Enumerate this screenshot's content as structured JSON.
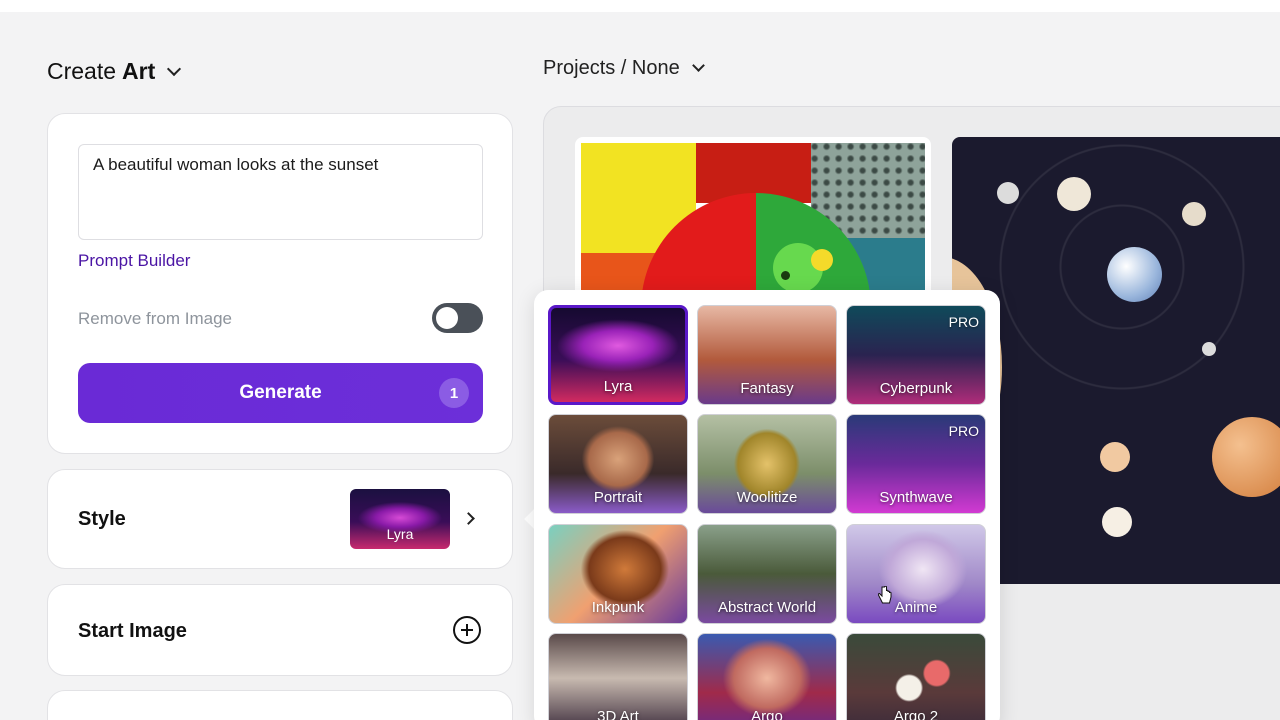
{
  "header": {
    "create_prefix": "Create",
    "create_bold": "Art",
    "projects_label": "Projects / None"
  },
  "prompt": {
    "text": "A beautiful woman looks at the sunset",
    "builder_link": "Prompt Builder",
    "remove_label": "Remove from Image",
    "remove_toggle_on": false,
    "generate_label": "Generate",
    "generate_count": "1"
  },
  "style_card": {
    "label": "Style",
    "selected_style": "Lyra"
  },
  "start_image": {
    "label": "Start Image"
  },
  "styles": [
    {
      "name": "Lyra",
      "pro": "",
      "selected": true
    },
    {
      "name": "Fantasy",
      "pro": ""
    },
    {
      "name": "Cyberpunk",
      "pro": "PRO"
    },
    {
      "name": "Portrait",
      "pro": ""
    },
    {
      "name": "Woolitize",
      "pro": ""
    },
    {
      "name": "Synthwave",
      "pro": "PRO"
    },
    {
      "name": "Inkpunk",
      "pro": ""
    },
    {
      "name": "Abstract World",
      "pro": ""
    },
    {
      "name": "Anime",
      "pro": ""
    },
    {
      "name": "3D Art",
      "pro": ""
    },
    {
      "name": "Argo",
      "pro": ""
    },
    {
      "name": "Argo 2",
      "pro": ""
    }
  ],
  "colors": {
    "accent": "#6a2ad6",
    "link": "#4a14a4",
    "toggle_off": "#4a5058"
  }
}
